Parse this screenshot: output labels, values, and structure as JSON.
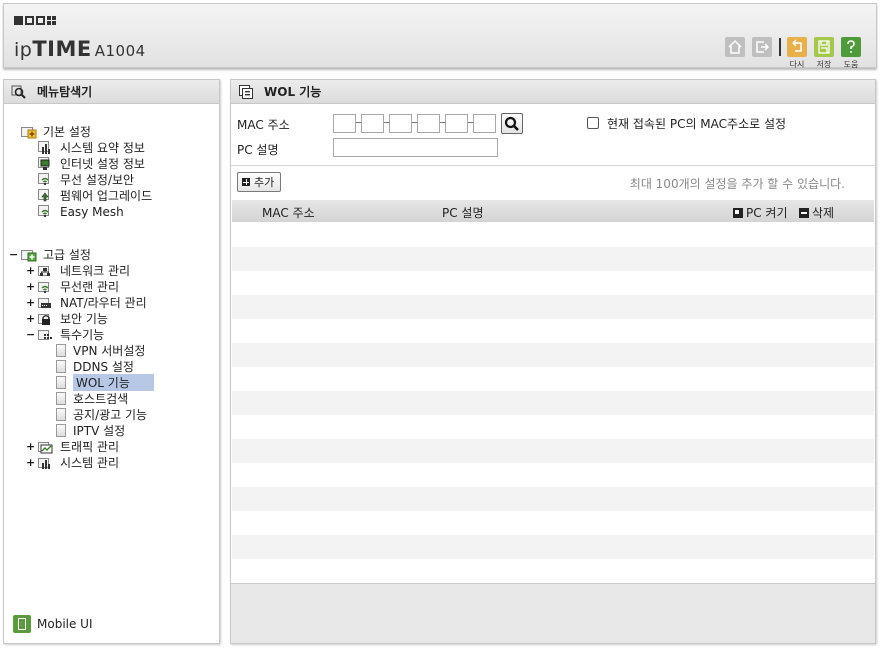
{
  "header": {
    "logo_prefix": "ip",
    "logo_bold": "TIME",
    "model": "A1004",
    "icons": [
      "home-icon",
      "logout-icon",
      "undo-icon",
      "save-icon",
      "help-icon"
    ],
    "undo_label": "다시",
    "save_label": "저장",
    "help_label": "도움"
  },
  "sidebar": {
    "title": "메뉴탐색기",
    "basic": {
      "label": "기본 설정",
      "items": [
        "시스템 요약 정보",
        "인터넷 설정 정보",
        "무선 설정/보안",
        "펌웨어 업그레이드",
        "Easy Mesh"
      ]
    },
    "advanced": {
      "label": "고급 설정",
      "items": [
        "네트워크 관리",
        "무선랜 관리",
        "NAT/라우터 관리",
        "보안 기능",
        "특수기능",
        "트래픽 관리",
        "시스템 관리"
      ],
      "special_items": [
        "VPN 서버설정",
        "DDNS 설정",
        "WOL 기능",
        "호스트검색",
        "공지/광고 기능",
        "IPTV 설정"
      ]
    },
    "expand_plus": "+",
    "expand_minus": "−",
    "mobile_ui": "Mobile UI"
  },
  "main": {
    "title": "WOL 기능",
    "mac_label": "MAC 주소",
    "pc_desc_label": "PC 설명",
    "current_pc_label": "현재 접속된 PC의 MAC주소로 설정",
    "add_button": "추가",
    "limit_note": "최대 100개의 설정을 추가 할 수 있습니다.",
    "columns": {
      "mac": "MAC 주소",
      "desc": "PC 설명",
      "wake": "PC 켜기",
      "delete": "삭제"
    }
  },
  "colors": {
    "undo": "#e8b04b",
    "save": "#a5c74a",
    "help": "#4f9a3b",
    "selected": "#b6c8e6"
  }
}
